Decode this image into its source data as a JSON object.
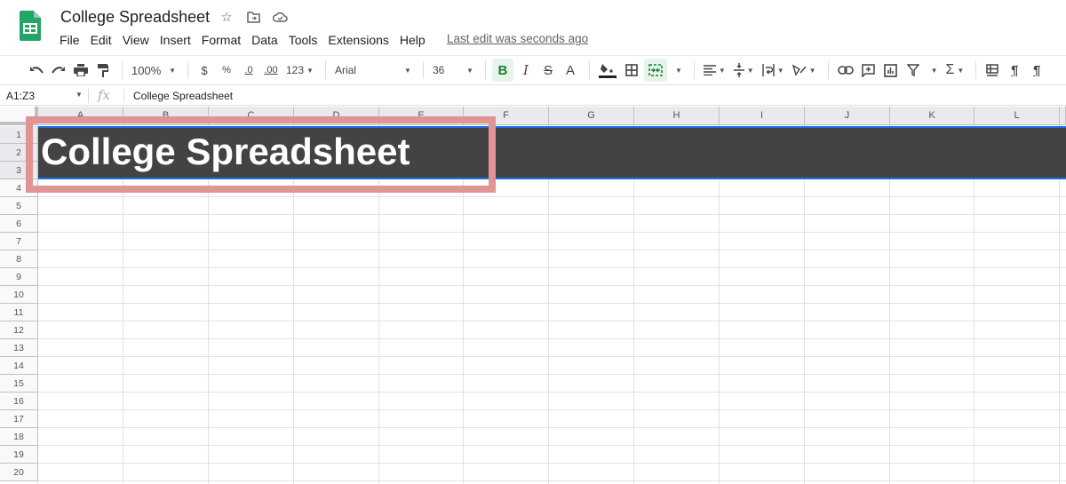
{
  "app": {
    "doc_title": "College Spreadsheet",
    "title_icons": [
      {
        "name": "star-icon",
        "glyph": "☆"
      },
      {
        "name": "move-to-folder-icon",
        "glyph": "⊡"
      },
      {
        "name": "cloud-saved-icon",
        "glyph": "☁"
      }
    ],
    "menu": [
      "File",
      "Edit",
      "View",
      "Insert",
      "Format",
      "Data",
      "Tools",
      "Extensions",
      "Help"
    ],
    "last_edit": "Last edit was seconds ago"
  },
  "toolbar": {
    "undo": "↶",
    "redo": "↷",
    "print": "⎙",
    "paint_format": "🖌",
    "zoom": "100%",
    "currency": "$",
    "percent": "%",
    "decrease_decimal": ".0",
    "increase_decimal": ".00",
    "more_formats": "123",
    "font": "Arial",
    "font_size": "36",
    "bold": "B",
    "italic": "I",
    "strikethrough": "S",
    "text_color": "A",
    "fill_color": "◆",
    "borders": "⊞",
    "merge_cells": "⇹",
    "h_align": "≡",
    "v_align": "÷",
    "wrap": "⇥",
    "rotate": "⟋",
    "link": "⊂⊃",
    "comment": "⊞",
    "chart": "▥",
    "filter": "▽",
    "functions": "Σ",
    "freeze": "⊟",
    "ltr": "¶",
    "rtl": "¶"
  },
  "formula_bar": {
    "name_box": "A1:Z3",
    "fx": "fx",
    "value": "College Spreadsheet"
  },
  "sheet": {
    "columns": [
      "A",
      "B",
      "C",
      "D",
      "E",
      "F",
      "G",
      "H",
      "I",
      "J",
      "K",
      "L"
    ],
    "rows": [
      "1",
      "2",
      "3",
      "4",
      "5",
      "6",
      "7",
      "8",
      "9",
      "10",
      "11",
      "12",
      "13",
      "14",
      "15",
      "16",
      "17",
      "18",
      "19",
      "20"
    ],
    "selected_rows": [
      "1",
      "2",
      "3"
    ],
    "merged_cell_text": "College Spreadsheet",
    "merged_fill": "#434343",
    "selection_color": "#1a73e8",
    "annotation_color": "#e09494"
  }
}
